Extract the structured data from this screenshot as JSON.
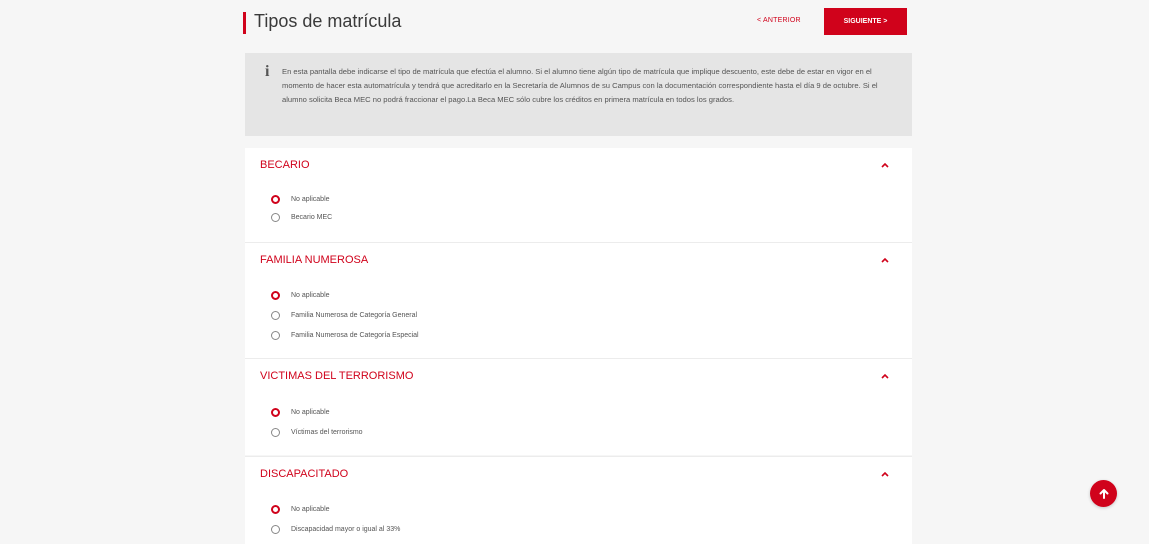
{
  "header": {
    "title": "Tipos de matrícula",
    "prev_label": "< ANTERIOR",
    "next_label": "SIGUIENTE >"
  },
  "info": {
    "icon": "info-icon",
    "text": "En esta pantalla debe indicarse el tipo de matrícula que efectúa el alumno. Si el alumno tiene algún tipo de matrícula que implique descuento, este debe de estar en vigor en el momento de hacer esta automatrícula y tendrá que acreditarlo en la Secretaría de Alumnos de su Campus con la documentación correspondiente hasta el día 9 de octubre. Si el alumno solicita Beca MEC no podrá fraccionar el pago.La Beca MEC sólo cubre los créditos en primera matrícula en todos los grados."
  },
  "sections": [
    {
      "title": "BECARIO",
      "options": [
        {
          "label": "No aplicable",
          "checked": true
        },
        {
          "label": "Becario MEC",
          "checked": false
        }
      ]
    },
    {
      "title": "FAMILIA NUMEROSA",
      "options": [
        {
          "label": "No aplicable",
          "checked": true
        },
        {
          "label": "Familia Numerosa de Categoría General",
          "checked": false
        },
        {
          "label": "Familia Numerosa de Categoría Especial",
          "checked": false
        }
      ]
    },
    {
      "title": "VICTIMAS DEL TERRORISMO",
      "options": [
        {
          "label": "No aplicable",
          "checked": true
        },
        {
          "label": "Víctimas del terrorismo",
          "checked": false
        }
      ]
    },
    {
      "title": "DISCAPACITADO",
      "options": [
        {
          "label": "No aplicable",
          "checked": true
        },
        {
          "label": "Discapacidad mayor o igual al 33%",
          "checked": false
        }
      ]
    }
  ],
  "colors": {
    "accent": "#d0021b",
    "background": "#f6f6f6",
    "info_background": "#e5e5e5"
  }
}
